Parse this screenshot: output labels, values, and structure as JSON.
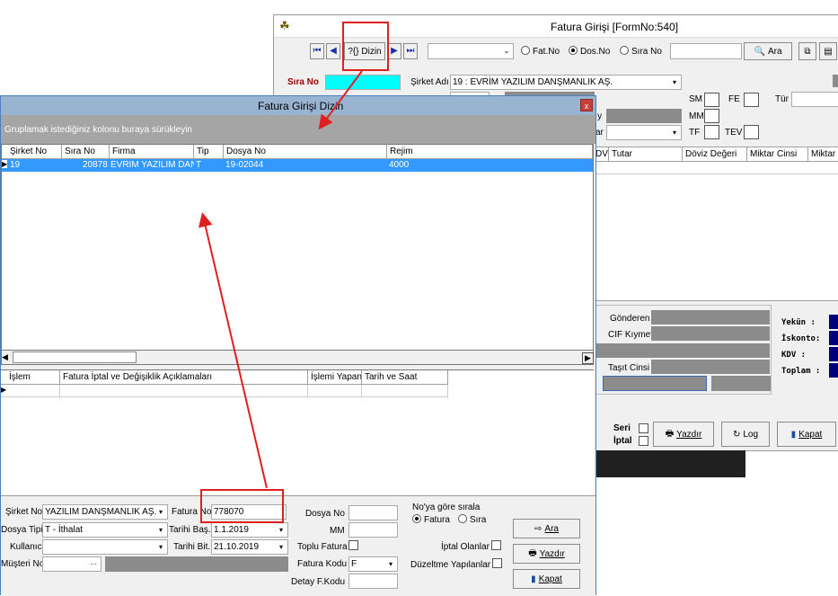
{
  "back": {
    "title": "Fatura Girişi [FormNo:540]",
    "dizin_label": "?{} Dizin",
    "radio_fatno": "Fat.No",
    "radio_dosno": "Dos.No",
    "radio_sirano": "Sıra No",
    "ara_label": "Ara",
    "sira_no_label": "Sıra No",
    "sirket_adi_label": "Şirket Adı",
    "sirket_adi_value": "19 : EVRİM YAZILIM DANŞMANLIK AŞ.",
    "sm": "SM",
    "fe": "FE",
    "tur": "Tür",
    "mm": "MM",
    "tf": "TF",
    "tev": "TEV",
    "frag_y": "y",
    "frag_ar": "ar",
    "col_dv": "DV",
    "col_tutar": "Tutar",
    "col_doviz": "Döviz Değeri",
    "col_miktar_cinsi": "Miktar Cinsi",
    "col_miktar": "Miktar",
    "gonderen": "Gönderen",
    "cif": "CIF Kıymet",
    "tasit": "Taşıt Cinsi",
    "yekun": "Yekün  :",
    "iskonto": "İskonto:",
    "kdv": "KDV    :",
    "toplam": "Toplam :",
    "seri": "Seri",
    "iptal": "İptal",
    "yazdir": "Yazdır",
    "log": "Log",
    "kapat": "Kapat"
  },
  "dlg": {
    "title": "Fatura Girişi Dizin",
    "group_hint": "Gruplamak istediğiniz kolonu buraya sürükleyin",
    "cols": [
      "Şirket No",
      "Sıra No",
      "Firma",
      "Tip",
      "Dosya No",
      "Rejim"
    ],
    "row": {
      "sirket": "19",
      "sira": "20878",
      "firma": "EVRİM YAZILIM DAN",
      "tip": "T",
      "dosya": "19-02044",
      "rejim": "4000"
    },
    "cols2": [
      "İşlem",
      "Fatura İptal ve Değişiklik Açıklamaları",
      "İşlemi Yapan",
      "Tarih ve Saat"
    ],
    "f_sirket_label": "Şirket No",
    "f_sirket_value": "YAZILIM DANŞMANLIK AŞ.",
    "f_dosyatipi_label": "Dosya Tipi",
    "f_dosyatipi_value": "T - İthalat",
    "f_kullanici_label": "Kullanıcı",
    "f_musteri_label": "Müşteri No",
    "f_fatura_label": "Fatura No",
    "f_fatura_value": "778070",
    "f_tbas_label": "Tarihi Baş.",
    "f_tbas_value": "1.1.2019",
    "f_tbit_label": "Tarihi Bit.",
    "f_tbit_value": "21.10.2019",
    "f_dosyano_label": "Dosya No",
    "f_mm_label": "MM",
    "f_toplu_label": "Toplu Fatura",
    "f_kodu_label": "Fatura Kodu",
    "f_kodu_value": "F",
    "f_detay_label": "Detay F.Kodu",
    "sort_title": "No'ya göre sırala",
    "sort_fatura": "Fatura",
    "sort_sira": "Sıra",
    "iptal_olanlar": "İptal Olanlar",
    "duzeltme": "Düzeltme Yapılanlar",
    "btn_ara": "Ara",
    "btn_yazdir": "Yazdır",
    "btn_kapat": "Kapat"
  },
  "colors": {
    "accent_red": "#e02020",
    "selection": "#3399ff",
    "title_bg": "#99b4d1"
  }
}
